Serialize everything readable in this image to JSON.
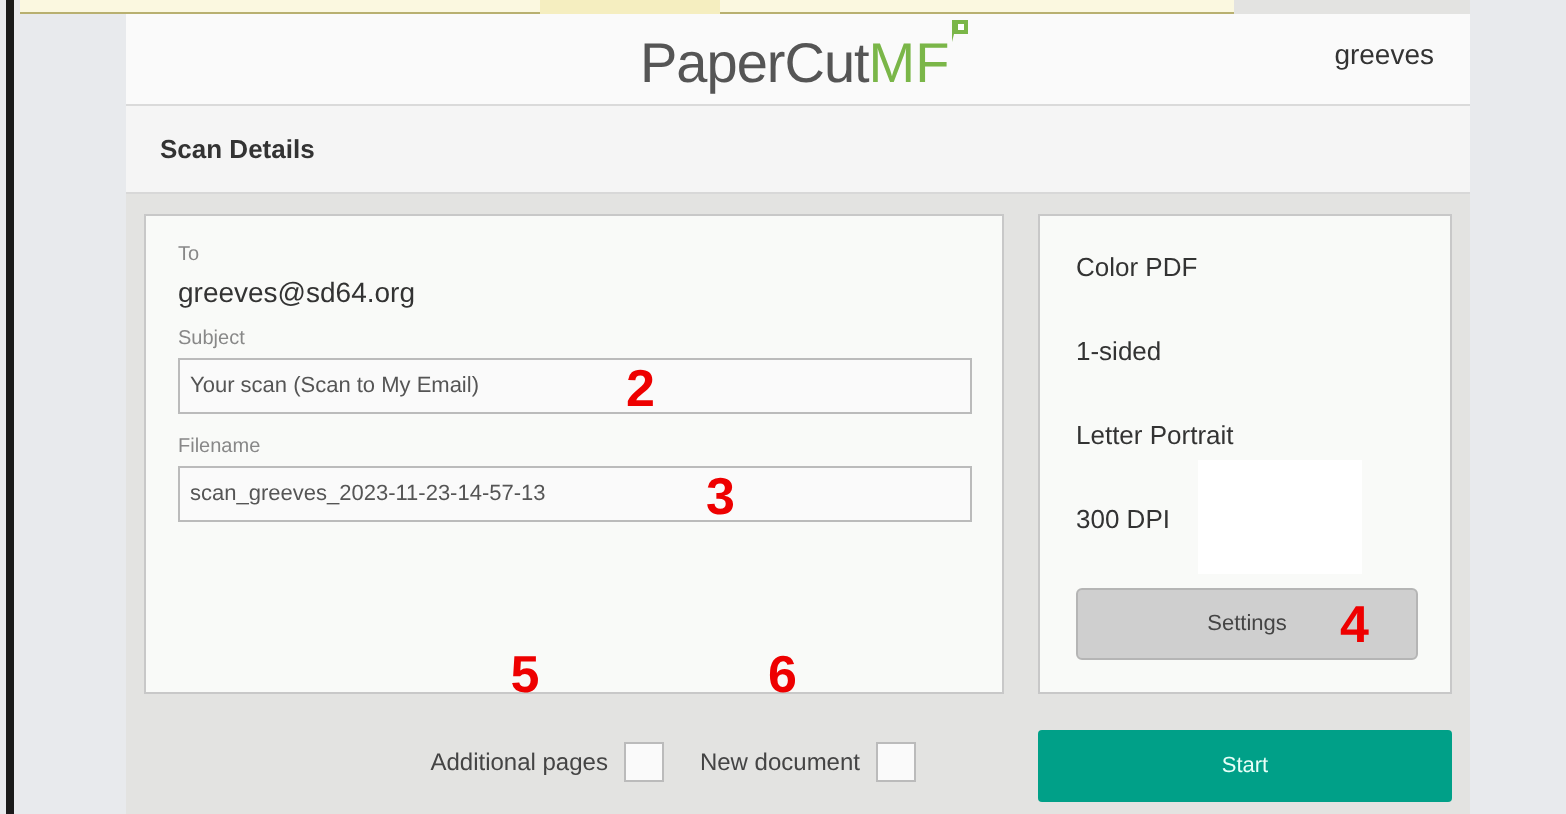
{
  "header": {
    "logo": {
      "text": "PaperCut",
      "accent": "MF"
    },
    "user": "greeves"
  },
  "title": "Scan Details",
  "recipient": {
    "label": "To",
    "value": "greeves@sd64.org"
  },
  "fields": [
    {
      "label": "Subject",
      "value": "Your scan (Scan to My Email)",
      "annotation": "2"
    },
    {
      "label": "Filename",
      "value": "scan_greeves_2023-11-23-14-57-13",
      "annotation": "3"
    }
  ],
  "settings": [
    "Color PDF",
    "1-sided",
    "Letter Portrait",
    "300 DPI"
  ],
  "settings_button": {
    "label": "Settings",
    "annotation": "4"
  },
  "checkboxes": [
    {
      "label": "Additional pages",
      "checked": false,
      "annotation": "5"
    },
    {
      "label": "New document",
      "checked": false,
      "annotation": "6"
    }
  ],
  "start_button": {
    "label": "Start"
  }
}
